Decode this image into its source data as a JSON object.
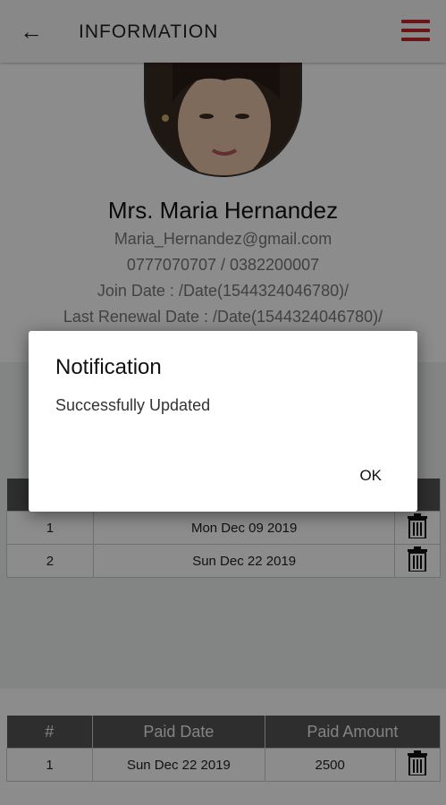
{
  "header": {
    "title": "INFORMATION"
  },
  "profile": {
    "name": "Mrs. Maria Hernandez",
    "email": "Maria_Hernandez@gmail.com",
    "phones": "0777070707 / 0382200007",
    "join_date": "Join Date : /Date(1544324046780)/",
    "renewal_date": "Last Renewal Date : /Date(1544324046780)/"
  },
  "schedule": {
    "rows": [
      {
        "num": "1",
        "date": "Mon Dec 09 2019"
      },
      {
        "num": "2",
        "date": "Sun Dec 22 2019"
      }
    ]
  },
  "payments": {
    "headers": [
      "#",
      "Paid Date",
      "Paid Amount"
    ],
    "rows": [
      {
        "num": "1",
        "date": "Sun Dec 22 2019",
        "amount": "2500"
      }
    ]
  },
  "dialog": {
    "title": "Notification",
    "message": "Successfully Updated",
    "ok_label": "OK"
  }
}
